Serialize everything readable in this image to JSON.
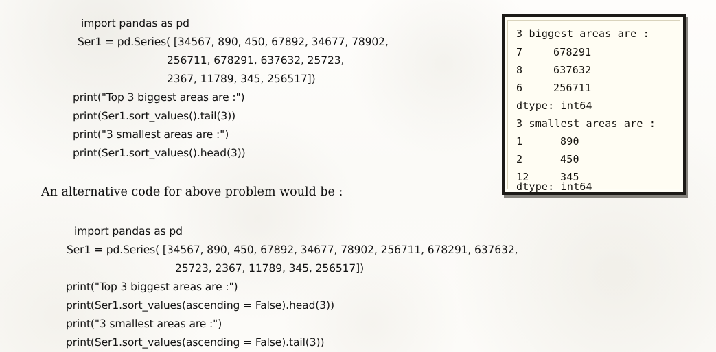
{
  "document": {
    "kind": "scanned-textbook-page",
    "paper_color": "#fdfcfa",
    "ink_color": "#141414"
  },
  "code_block_1": {
    "name": "first-solution-code",
    "lines": [
      "import pandas as pd",
      "Ser1 = pd.Series( [34567, 890, 450, 67892, 34677, 78902,",
      "256711, 678291, 637632, 25723,",
      "2367, 11789, 345, 256517])",
      "print(\"Top 3 biggest areas are :\")",
      "print(Ser1.sort_values().tail(3))",
      "print(\"3 smallest areas are :\")",
      "print(Ser1.sort_values().head(3))"
    ]
  },
  "output_box": {
    "name": "console-output",
    "header_1": "3 biggest areas are :",
    "biggest_rows": [
      {
        "index": "7",
        "value": "678291"
      },
      {
        "index": "8",
        "value": "637632"
      },
      {
        "index": "6",
        "value": "256711"
      }
    ],
    "dtype_1": "dtype: int64",
    "header_2": "3 smallest areas are :",
    "smallest_rows": [
      {
        "index": "1",
        "value": "890"
      },
      {
        "index": "2",
        "value": "450"
      },
      {
        "index": "12",
        "value": "345"
      }
    ],
    "dtype_2": "dtype: int64"
  },
  "prose": {
    "alternative_intro": "An alternative code for above problem would be :"
  },
  "code_block_2": {
    "name": "alternative-solution-code",
    "lines": [
      "import pandas as pd",
      "Ser1 = pd.Series( [34567, 890, 450, 67892, 34677, 78902, 256711, 678291, 637632,",
      "25723, 2367, 11789, 345, 256517])",
      "print(\"Top 3 biggest areas are :\")",
      "print(Ser1.sort_values(ascending = False).head(3))",
      "print(\"3 smallest areas are :\")",
      "print(Ser1.sort_values(ascending = False).tail(3))"
    ]
  }
}
